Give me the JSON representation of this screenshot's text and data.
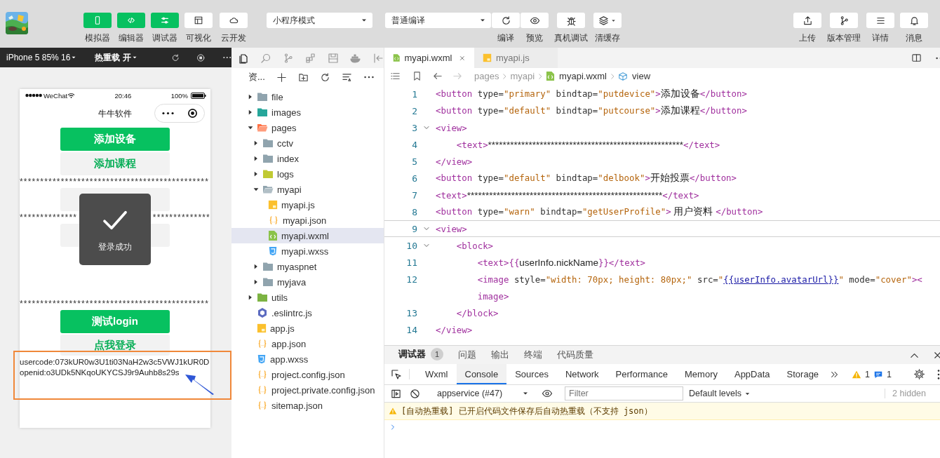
{
  "toolbar": {
    "view_toggles": [
      {
        "label": "模拟器",
        "on": true
      },
      {
        "label": "编辑器",
        "on": true
      },
      {
        "label": "调试器",
        "on": true
      },
      {
        "label": "可视化",
        "on": false
      },
      {
        "label": "云开发",
        "on": false
      }
    ],
    "mode_select": "小程序模式",
    "compile_select": "普通编译",
    "actions": [
      "编译",
      "预览",
      "真机调试",
      "清缓存"
    ],
    "right_actions": [
      "上传",
      "版本管理",
      "详情",
      "消息"
    ]
  },
  "simulator": {
    "device": "iPhone 5 85% 16",
    "hot_reload": "热重载 开",
    "status_bar": {
      "carrier": "WeChat",
      "time": "20:46",
      "battery": "100%"
    },
    "nav_title": "牛牛软件",
    "content": [
      {
        "kind": "primary_button",
        "label": "添加设备"
      },
      {
        "kind": "default_button",
        "label": "添加课程"
      },
      {
        "kind": "stars",
        "text": "**********************************************"
      },
      {
        "kind": "default_button"
      },
      {
        "kind": "stars_covered",
        "left": "**************",
        "right": "**************"
      },
      {
        "kind": "default_button"
      },
      {
        "kind": "blank"
      },
      {
        "kind": "stars",
        "text": "**********************************************"
      },
      {
        "kind": "primary_button",
        "label": "测试login"
      },
      {
        "kind": "default_button",
        "label": "点我登录"
      },
      {
        "kind": "output",
        "text": "usercode:073kUR0w3U1ti03NaH2w3c5VWJ1kUR0D"
      },
      {
        "kind": "output",
        "text": "openid:o3UDk5NKqoUKYCSJ9r9Auhb8s29s"
      }
    ],
    "toast": {
      "text": "登录成功"
    }
  },
  "explorer": {
    "title": "资...",
    "tree": [
      {
        "name": "file",
        "kind": "folder",
        "expanded": false,
        "selected": false
      },
      {
        "name": "images",
        "kind": "images_folder",
        "expanded": false,
        "selected": false
      },
      {
        "name": "pages",
        "kind": "pages_folder",
        "expanded": true,
        "selected": false,
        "children": [
          {
            "name": "cctv",
            "kind": "folder",
            "expanded": false,
            "selected": false
          },
          {
            "name": "index",
            "kind": "folder",
            "expanded": false,
            "selected": false
          },
          {
            "name": "logs",
            "kind": "logs_folder",
            "expanded": false,
            "selected": false
          },
          {
            "name": "myapi",
            "kind": "folder",
            "expanded": true,
            "selected": false,
            "children": [
              {
                "name": "myapi.js",
                "kind": "js_file",
                "selected": false
              },
              {
                "name": "myapi.json",
                "kind": "json_file",
                "selected": false
              },
              {
                "name": "myapi.wxml",
                "kind": "wxml_file",
                "selected": true
              },
              {
                "name": "myapi.wxss",
                "kind": "wxss_file",
                "selected": false
              }
            ]
          },
          {
            "name": "myaspnet",
            "kind": "folder",
            "expanded": false,
            "selected": false
          },
          {
            "name": "myjava",
            "kind": "folder",
            "expanded": false,
            "selected": false
          }
        ]
      },
      {
        "name": "utils",
        "kind": "utils_folder",
        "expanded": false,
        "selected": false
      },
      {
        "name": ".eslintrc.js",
        "kind": "eslint_file",
        "selected": false
      },
      {
        "name": "app.js",
        "kind": "js_file",
        "selected": false
      },
      {
        "name": "app.json",
        "kind": "json_file",
        "selected": false
      },
      {
        "name": "app.wxss",
        "kind": "wxss_file",
        "selected": false
      },
      {
        "name": "project.config.json",
        "kind": "json_file",
        "selected": false
      },
      {
        "name": "project.private.config.json",
        "kind": "json_file",
        "selected": false
      },
      {
        "name": "sitemap.json",
        "kind": "json_file",
        "selected": false
      }
    ]
  },
  "editor": {
    "tabs": [
      {
        "label": "myapi.wxml",
        "selected": true,
        "closable": true
      },
      {
        "label": "myapi.js",
        "selected": false,
        "closable": false
      }
    ],
    "breadcrumb": [
      "pages",
      "myapi",
      "myapi.wxml",
      "view"
    ],
    "lines": [
      {
        "number": "1",
        "foldable": false,
        "current": false,
        "tokens": [
          {
            "kind": "tag",
            "text": "<button"
          },
          {
            "kind": "attr",
            "text": " type="
          },
          {
            "kind": "str",
            "text": "\"primary\""
          },
          {
            "kind": "attr",
            "text": " bindtap="
          },
          {
            "kind": "str",
            "text": "\"putdevice\""
          },
          {
            "kind": "tag",
            "text": ">"
          },
          {
            "kind": "text",
            "text": "添加设备"
          },
          {
            "kind": "tag",
            "text": "</button>"
          }
        ]
      },
      {
        "number": "2",
        "foldable": false,
        "current": false,
        "tokens": [
          {
            "kind": "tag",
            "text": "<button"
          },
          {
            "kind": "attr",
            "text": " type="
          },
          {
            "kind": "str",
            "text": "\"default\""
          },
          {
            "kind": "attr",
            "text": " bindtap="
          },
          {
            "kind": "str",
            "text": "\"putcourse\""
          },
          {
            "kind": "tag",
            "text": ">"
          },
          {
            "kind": "text",
            "text": "添加课程"
          },
          {
            "kind": "tag",
            "text": "</button>"
          }
        ]
      },
      {
        "number": "3",
        "foldable": true,
        "current": false,
        "tokens": [
          {
            "kind": "tag",
            "text": "<view>"
          }
        ]
      },
      {
        "number": "4",
        "foldable": false,
        "current": false,
        "tokens": [
          {
            "kind": "tag",
            "text": "    <text>"
          },
          {
            "kind": "text",
            "text": "*****************************************************"
          },
          {
            "kind": "tag",
            "text": "</text>"
          }
        ]
      },
      {
        "number": "5",
        "foldable": false,
        "current": false,
        "tokens": [
          {
            "kind": "tag",
            "text": "</view>"
          }
        ]
      },
      {
        "number": "6",
        "foldable": false,
        "current": false,
        "tokens": [
          {
            "kind": "tag",
            "text": "<button"
          },
          {
            "kind": "attr",
            "text": " type="
          },
          {
            "kind": "str",
            "text": "\"default\""
          },
          {
            "kind": "attr",
            "text": " bindtap="
          },
          {
            "kind": "str",
            "text": "\"delbook\""
          },
          {
            "kind": "tag",
            "text": ">"
          },
          {
            "kind": "text",
            "text": "开始投票"
          },
          {
            "kind": "tag",
            "text": "</button>"
          }
        ]
      },
      {
        "number": "7",
        "foldable": false,
        "current": false,
        "tokens": [
          {
            "kind": "tag",
            "text": "<text>"
          },
          {
            "kind": "text",
            "text": "*****************************************************"
          },
          {
            "kind": "tag",
            "text": "</text>"
          }
        ]
      },
      {
        "number": "8",
        "foldable": false,
        "current": false,
        "tokens": [
          {
            "kind": "tag",
            "text": "<button"
          },
          {
            "kind": "attr",
            "text": " type="
          },
          {
            "kind": "str",
            "text": "\"warn\""
          },
          {
            "kind": "attr",
            "text": " bindtap="
          },
          {
            "kind": "str",
            "text": "\"getUserProfile\""
          },
          {
            "kind": "tag",
            "text": ">"
          },
          {
            "kind": "text",
            "text": " 用户资料 "
          },
          {
            "kind": "tag",
            "text": "</button>"
          }
        ]
      },
      {
        "number": "9",
        "foldable": true,
        "current": true,
        "tokens": [
          {
            "kind": "tag",
            "text": "<view>"
          }
        ]
      },
      {
        "number": "10",
        "foldable": true,
        "current": false,
        "tokens": [
          {
            "kind": "tag",
            "text": "    <block>"
          }
        ]
      },
      {
        "number": "11",
        "foldable": false,
        "current": false,
        "tokens": [
          {
            "kind": "tag",
            "text": "        <text>"
          },
          {
            "kind": "brace",
            "text": "{{"
          },
          {
            "kind": "text",
            "text": "userInfo.nickName"
          },
          {
            "kind": "brace",
            "text": "}}"
          },
          {
            "kind": "tag",
            "text": "</text>"
          }
        ]
      },
      {
        "number": "12",
        "foldable": false,
        "current": false,
        "tokens": [
          {
            "kind": "tag",
            "text": "        <image"
          },
          {
            "kind": "attr",
            "text": " style="
          },
          {
            "kind": "str",
            "text": "\"width: 70px; height: 80px;\""
          },
          {
            "kind": "attr",
            "text": " src="
          },
          {
            "kind": "str",
            "text": "\""
          },
          {
            "kind": "link",
            "text": "{{userInfo.avatarUrl}}"
          },
          {
            "kind": "str",
            "text": "\""
          },
          {
            "kind": "attr",
            "text": " mode="
          },
          {
            "kind": "str",
            "text": "\"cover\""
          },
          {
            "kind": "tag",
            "text": "><"
          }
        ]
      },
      {
        "foldable": false,
        "current": false,
        "tokens": [
          {
            "kind": "tag",
            "text": "        image>"
          }
        ]
      },
      {
        "number": "13",
        "foldable": false,
        "current": false,
        "tokens": [
          {
            "kind": "tag",
            "text": "    </block>"
          }
        ]
      },
      {
        "number": "14",
        "foldable": false,
        "current": false,
        "tokens": [
          {
            "kind": "tag",
            "text": "</view>"
          }
        ]
      }
    ]
  },
  "devtools": {
    "panel_tabs": [
      {
        "label": "调试器",
        "selected": true,
        "badge": "1"
      },
      {
        "label": "问题",
        "selected": false
      },
      {
        "label": "输出",
        "selected": false
      },
      {
        "label": "终端",
        "selected": false
      },
      {
        "label": "代码质量",
        "selected": false
      }
    ],
    "tabs": [
      {
        "label": "Wxml",
        "selected": false
      },
      {
        "label": "Console",
        "selected": true
      },
      {
        "label": "Sources",
        "selected": false
      },
      {
        "label": "Network",
        "selected": false
      },
      {
        "label": "Performance",
        "selected": false
      },
      {
        "label": "Memory",
        "selected": false
      },
      {
        "label": "AppData",
        "selected": false
      },
      {
        "label": "Storage",
        "selected": false
      }
    ],
    "warning_count": "1",
    "info_count": "1",
    "context": "appservice (#47)",
    "filter": {
      "placeholder": "Filter"
    },
    "levels": "Default levels",
    "hidden_count": "2 hidden",
    "log": [
      {
        "kind": "warning",
        "text": "[自动热重载] 已开启代码文件保存后自动热重载（不支持 json）"
      }
    ]
  }
}
